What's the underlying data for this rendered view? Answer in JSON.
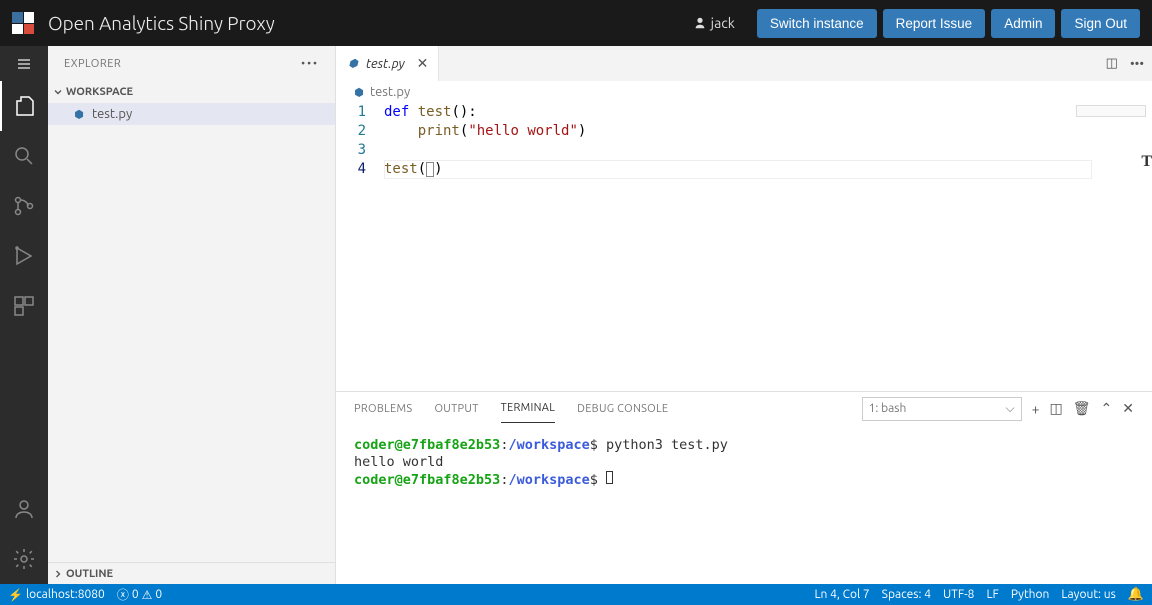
{
  "topbar": {
    "title": "Open Analytics Shiny Proxy",
    "username": "jack",
    "buttons": {
      "switch": "Switch instance",
      "report": "Report Issue",
      "admin": "Admin",
      "signout": "Sign Out"
    }
  },
  "sidebar": {
    "header": "EXPLORER",
    "workspace_label": "WORKSPACE",
    "files": [
      "test.py"
    ],
    "outline_label": "OUTLINE"
  },
  "editor": {
    "tab_name": "test.py",
    "breadcrumb": "test.py",
    "lines": {
      "l1_def": "def",
      "l1_fn": "test",
      "l1_paren": "():",
      "l2_call": "print",
      "l2_open": "(",
      "l2_str": "\"hello world\"",
      "l2_close": ")",
      "l4_call": "test",
      "l4_open": "(",
      "l4_close": ")"
    }
  },
  "panel": {
    "tabs": {
      "problems": "PROBLEMS",
      "output": "OUTPUT",
      "terminal": "TERMINAL",
      "debug": "DEBUG CONSOLE"
    },
    "selected_shell": "1: bash"
  },
  "terminal": {
    "user_host": "coder@e7fbaf8e2b53",
    "path_sep": ":",
    "path": "/workspace",
    "prompt_end": "$",
    "cmd1": "python3 test.py",
    "out1": "hello world"
  },
  "status": {
    "remote": "localhost:8080",
    "errors": "0",
    "warnings": "0",
    "cursor": "Ln 4, Col 7",
    "spaces": "Spaces: 4",
    "encoding": "UTF-8",
    "eol": "LF",
    "lang": "Python",
    "layout": "Layout: us"
  }
}
